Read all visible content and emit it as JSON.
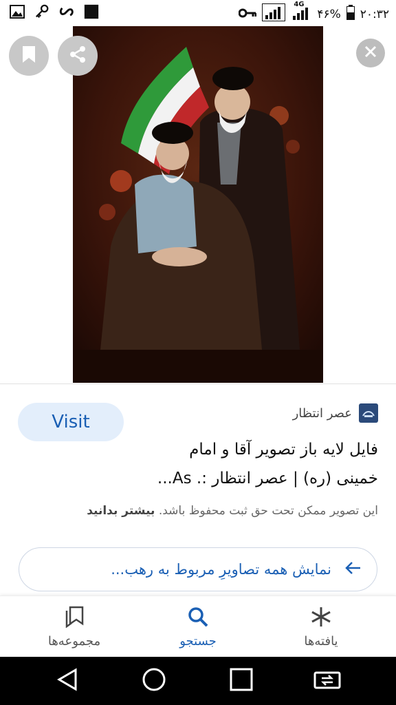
{
  "status_bar": {
    "time": "۲۰:۳۲",
    "battery": "۴۶%",
    "network": "4G",
    "left_icons": [
      "image-icon",
      "key-icon",
      "infinity-icon",
      "square-icon"
    ],
    "right_icons": [
      "vpn-key-icon",
      "signal-icon",
      "signal-4g-icon",
      "battery-icon"
    ]
  },
  "viewer": {
    "image_alt": "Photo",
    "actions": [
      "bookmark-icon",
      "share-icon",
      "close-icon"
    ]
  },
  "result": {
    "visit_label": "Visit",
    "source_name": "عصر انتظار",
    "title_line1": "فایل لایه باز تصویر آقا و امام",
    "title_line2": "خمینی (ره) | عصر انتظار :. As...",
    "copyright_note": "این تصویر ممکن تحت حق ثبت محفوظ باشد.",
    "learn_more": "بیشتر بدانید",
    "related_label": "نمایش همه تصاویرِ مربوط به رهب..."
  },
  "bottom_nav": {
    "items": [
      {
        "label": "یافته‌ها",
        "icon": "asterisk-icon"
      },
      {
        "label": "جستجو",
        "icon": "search-icon"
      },
      {
        "label": "مجموعه‌ها",
        "icon": "collections-icon"
      }
    ]
  },
  "colors": {
    "accent": "#1a5fb4",
    "visit_bg": "#e3eefb",
    "system_nav": "#000000"
  }
}
